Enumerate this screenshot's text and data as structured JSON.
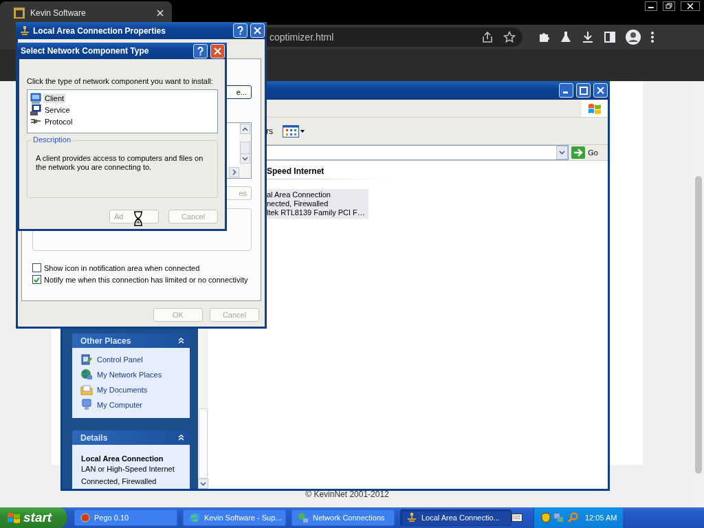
{
  "browser": {
    "tab_title": "Kevin Software",
    "url": "coptimizer.html",
    "footer": "© KevinNet 2001-2012"
  },
  "network_window": {
    "toolbar_text": "rs",
    "go": "Go",
    "group_header": "Speed Internet",
    "connection_lines": [
      "al Area Connection",
      "nected, Firewalled",
      "ltek RTL8139 Family PCI F…"
    ],
    "other_places": {
      "title": "Other Places",
      "items": [
        {
          "label": "Control Panel",
          "kind": "control"
        },
        {
          "label": "My Network Places",
          "kind": "network"
        },
        {
          "label": "My Documents",
          "kind": "documents"
        },
        {
          "label": "My Computer",
          "kind": "computer"
        }
      ]
    },
    "details": {
      "title": "Details",
      "heading": "Local Area Connection",
      "lines": [
        "LAN or High-Speed Internet",
        "Connected, Firewalled"
      ]
    }
  },
  "properties_dialog": {
    "title": "Local Area Connection Properties",
    "configure_button": "e...",
    "properties_button": {
      "label": "es",
      "disabled": true
    },
    "checkboxes": [
      {
        "label": "Show icon in notification area when connected",
        "checked": false
      },
      {
        "label": "Notify me when this connection has limited or no connectivity",
        "checked": true
      }
    ],
    "buttons": [
      {
        "label": "OK",
        "disabled": true
      },
      {
        "label": "Cancel",
        "disabled": true
      }
    ]
  },
  "select_dialog": {
    "title": "Select Network Component Type",
    "prompt": "Click the type of network component you want to install:",
    "items": [
      {
        "label": "Client",
        "kind": "client",
        "selected": true
      },
      {
        "label": "Service",
        "kind": "service",
        "selected": false
      },
      {
        "label": "Protocol",
        "kind": "protocol",
        "selected": false
      }
    ],
    "description_title": "Description",
    "description": "A client provides access to computers and files on the network you are connecting to.",
    "buttons": [
      {
        "label": "Ad",
        "disabled": true
      },
      {
        "label": "Cancel",
        "disabled": true
      }
    ]
  },
  "taskbar": {
    "start": "start",
    "tasks": [
      {
        "label": "Pego 0.10",
        "kind": "app",
        "selected": false
      },
      {
        "label": "Kevin Software - Sup...",
        "kind": "browser",
        "selected": false
      },
      {
        "label": "Network Connections",
        "kind": "network",
        "selected": false
      },
      {
        "label": "Local Area Connectio...",
        "kind": "connection",
        "selected": true
      }
    ],
    "clock": "12:05 AM"
  }
}
